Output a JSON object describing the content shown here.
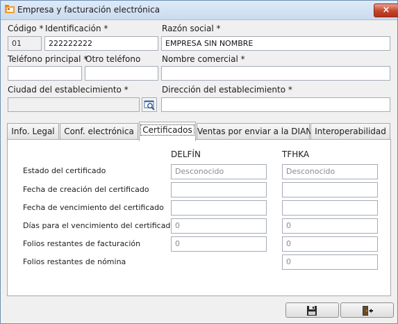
{
  "window": {
    "title": "Empresa y facturación electrónica",
    "close_label": "×"
  },
  "form": {
    "codigo": {
      "label": "Código *",
      "value": "01"
    },
    "identificacion": {
      "label": "Identificación *",
      "value": "222222222"
    },
    "razon_social": {
      "label": "Razón social *",
      "value": "EMPRESA SIN NOMBRE"
    },
    "telefono_principal": {
      "label": "Teléfono principal *",
      "value": ""
    },
    "otro_telefono": {
      "label": "Otro teléfono",
      "value": ""
    },
    "nombre_comercial": {
      "label": "Nombre comercial *",
      "value": ""
    },
    "ciudad": {
      "label": "Ciudad del establecimiento *",
      "value": ""
    },
    "direccion": {
      "label": "Dirección del establecimiento *",
      "value": ""
    }
  },
  "tabs": [
    {
      "label": "Info. Legal"
    },
    {
      "label": "Conf. electrónica"
    },
    {
      "label": "Certificados"
    },
    {
      "label": "Ventas por enviar a la DIAN"
    },
    {
      "label": "Interoperabilidad"
    }
  ],
  "active_tab": "Certificados",
  "certificados": {
    "columns": [
      "DELFÍN",
      "TFHKA"
    ],
    "rows": [
      {
        "label": "Estado del certificado",
        "delfin": "Desconocido",
        "tfhka": "Desconocido"
      },
      {
        "label": "Fecha de creación del certificado",
        "delfin": "",
        "tfhka": ""
      },
      {
        "label": "Fecha de vencimiento del certificado",
        "delfin": "",
        "tfhka": ""
      },
      {
        "label": "Días para el vencimiento del certificado",
        "delfin": "0",
        "tfhka": "0"
      },
      {
        "label": "Folios restantes de facturación",
        "delfin": "0",
        "tfhka": "0"
      },
      {
        "label": "Folios restantes de nómina",
        "tfhka": "0"
      }
    ]
  },
  "footer": {
    "save_icon": "floppy-disk-icon",
    "exit_icon": "door-exit-icon"
  },
  "colors": {
    "titlebar": "#c9dbef",
    "close": "#c4432b",
    "border": "#a5acb5"
  }
}
